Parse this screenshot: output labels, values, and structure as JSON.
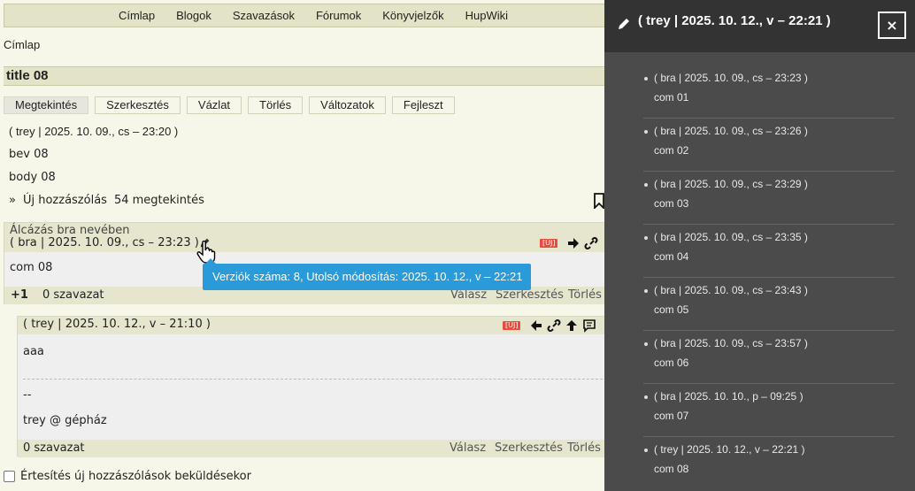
{
  "nav": {
    "items": [
      "Címlap",
      "Blogok",
      "Szavazások",
      "Fórumok",
      "Könyvjelzők",
      "HupWiki"
    ]
  },
  "breadcrumb": "Címlap",
  "node": {
    "title": "title 08",
    "tabs": [
      "Megtekintés",
      "Szerkesztés",
      "Vázlat",
      "Törlés",
      "Változatok",
      "Fejleszt"
    ],
    "meta": "( trey | 2025. 10. 09., cs – 23:20 )",
    "bev": "bev 08",
    "body": "body 08",
    "new_comment_prefix": "»",
    "new_comment": "Új hozzászólás",
    "views": "54 megtekintés"
  },
  "comment1": {
    "mask": "Álcázás bra nevében",
    "meta": "( bra | 2025. 10. 09., cs – 23:23 )",
    "badge": "[ÚJ]",
    "body": "com 08",
    "score": "+1",
    "votes": "0 szavazat",
    "reply": "Válasz",
    "edit": "Szerkesztés",
    "delete": "Törlés"
  },
  "tooltip": "Verziók száma: 8, Utolsó módosítás: 2025. 10. 12., v – 22:21",
  "comment2": {
    "meta": "( trey | 2025. 10. 12., v – 21:10 )",
    "badge": "[ÚJ]",
    "body": "aaa",
    "sig_sep": "--",
    "signature": "trey @ gépház",
    "votes": "0 szavazat",
    "reply": "Válasz",
    "edit": "Szerkesztés",
    "delete": "Törlés"
  },
  "notify_label": "Értesítés új hozzászólások beküldésekor",
  "panel": {
    "title": "( trey | 2025. 10. 12., v – 22:21 )",
    "close": "×",
    "items": [
      {
        "meta": "( bra | 2025. 10. 09., cs – 23:23 )",
        "body": "com 01"
      },
      {
        "meta": "( bra | 2025. 10. 09., cs – 23:26 )",
        "body": "com 02"
      },
      {
        "meta": "( bra | 2025. 10. 09., cs – 23:29 )",
        "body": "com 03"
      },
      {
        "meta": "( bra | 2025. 10. 09., cs – 23:35 )",
        "body": "com 04"
      },
      {
        "meta": "( bra | 2025. 10. 09., cs – 23:43 )",
        "body": "com 05"
      },
      {
        "meta": "( bra | 2025. 10. 09., cs – 23:57 )",
        "body": "com 06"
      },
      {
        "meta": "( bra | 2025. 10. 10., p – 09:25 )",
        "body": "com 07"
      },
      {
        "meta": "( trey | 2025. 10. 12., v – 22:21 )",
        "body": "com 08"
      }
    ]
  },
  "colors": {
    "page_bg": "#f7f7e9",
    "bar_bg": "#e3e3c8",
    "tooltip": "#2b9ad8",
    "panel_bg": "#4b4b4b",
    "panel_head": "#333333",
    "badge": "#e74c3c"
  }
}
